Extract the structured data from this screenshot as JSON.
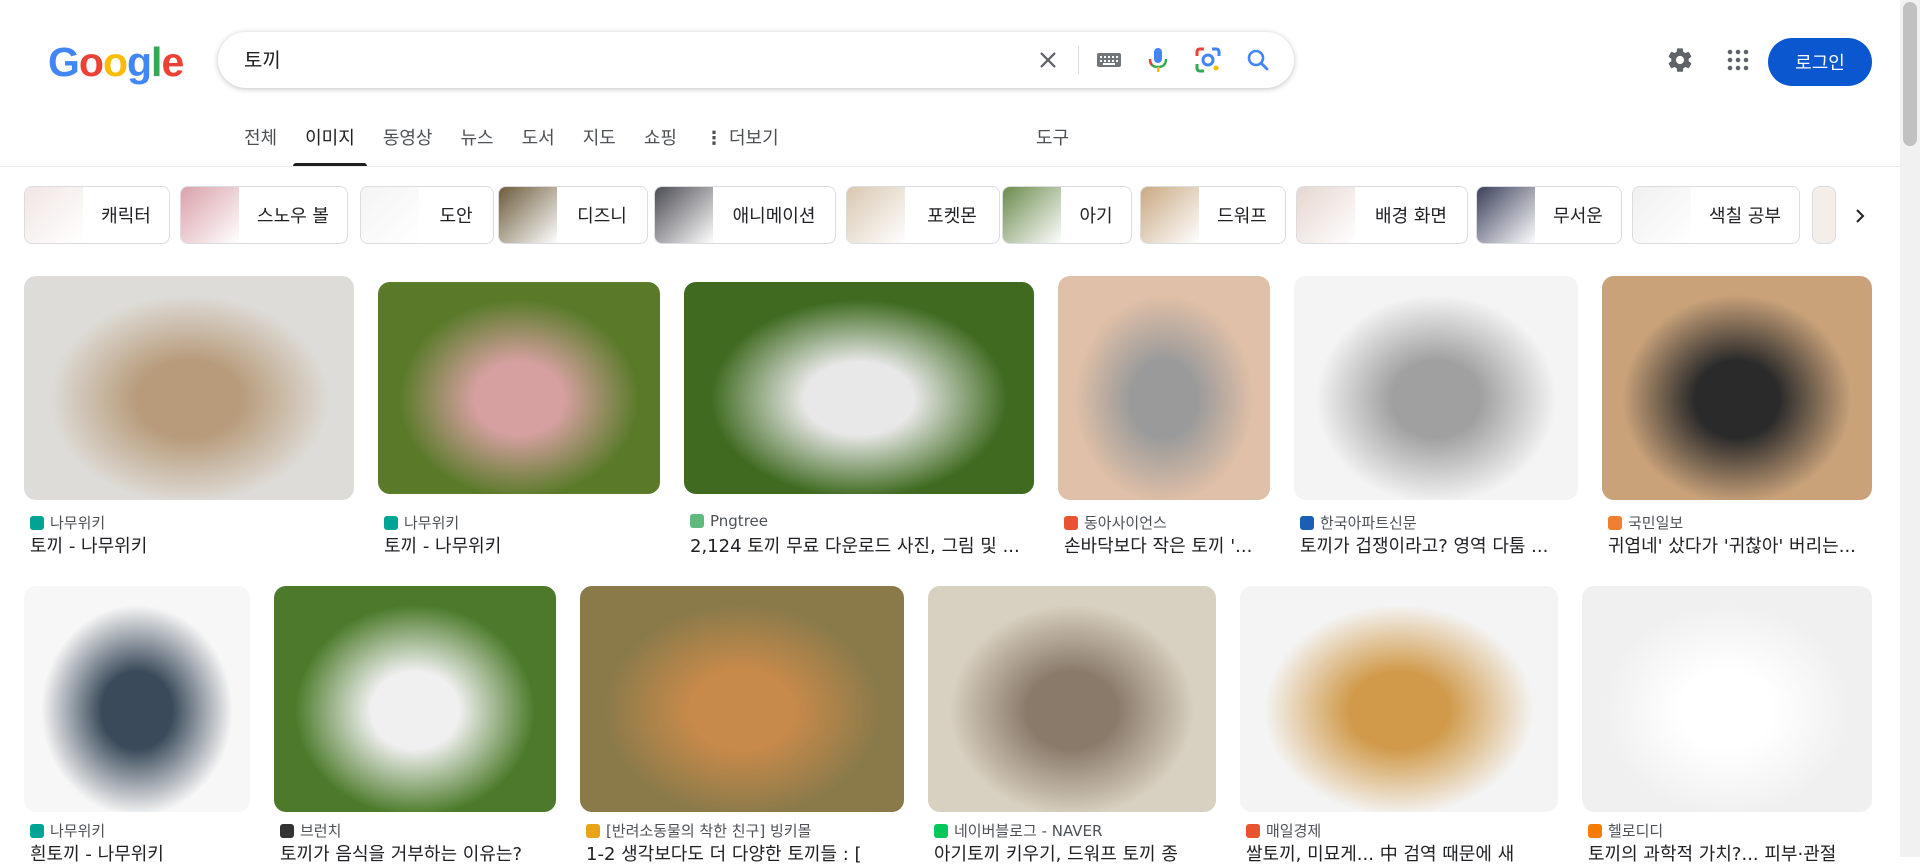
{
  "logo": {
    "letters": [
      "G",
      "o",
      "o",
      "g",
      "l",
      "e"
    ],
    "colors": [
      "#4285F4",
      "#EA4335",
      "#FBBC05",
      "#4285F4",
      "#34A853",
      "#EA4335"
    ]
  },
  "search": {
    "query": "토끼"
  },
  "header": {
    "login_label": "로그인"
  },
  "tabs": [
    {
      "label": "전체",
      "active": false
    },
    {
      "label": "이미지",
      "active": true
    },
    {
      "label": "동영상",
      "active": false
    },
    {
      "label": "뉴스",
      "active": false
    },
    {
      "label": "도서",
      "active": false
    },
    {
      "label": "지도",
      "active": false
    },
    {
      "label": "쇼핑",
      "active": false
    },
    {
      "label": "더보기",
      "active": false
    }
  ],
  "tools_label": "도구",
  "chips": [
    "캐릭터",
    "스노우 볼",
    "도안",
    "디즈니",
    "애니메이션",
    "포켓몬",
    "아기",
    "드워프",
    "배경 화면",
    "무서운",
    "색칠 공부"
  ],
  "results_row1": [
    {
      "source": "나무위키",
      "title": "토끼 - 나무위키",
      "fav_color": "#00a495"
    },
    {
      "source": "나무위키",
      "title": "토끼 - 나무위키",
      "fav_color": "#00a495"
    },
    {
      "source": "Pngtree",
      "title": "2,124 토끼 무료 다운로드 사진, 그림 및 ...",
      "fav_color": "#5fba7d"
    },
    {
      "source": "동아사이언스",
      "title": "손바닥보다 작은 토끼 '...",
      "fav_color": "#e8542f"
    },
    {
      "source": "한국아파트신문",
      "title": "토끼가 겁쟁이라고? 영역 다툼 ...",
      "fav_color": "#1a5fb4"
    },
    {
      "source": "국민일보",
      "title": "귀엽네' 샀다가 '귀찮아' 버리는...",
      "fav_color": "#f08030"
    }
  ],
  "results_row2": [
    {
      "source": "나무위키",
      "title": "흰토끼 - 나무위키",
      "fav_color": "#00a495"
    },
    {
      "source": "브런치",
      "title": "토끼가 음식을 거부하는 이유는?",
      "fav_color": "#333333"
    },
    {
      "source": "[반려소동물의 착한 친구] 빙키몰",
      "title": "1-2 생각보다도 더 다양한 토끼들 : [",
      "fav_color": "#e8a317"
    },
    {
      "source": "네이버블로그 - NAVER",
      "title": "아기토끼 키우기, 드워프 토끼 종",
      "fav_color": "#03c75a"
    },
    {
      "source": "매일경제",
      "title": "쌀토끼, 미묘게... 中 검역 때문에 새",
      "fav_color": "#e8542f"
    },
    {
      "source": "헬로디디",
      "title": "토끼의 과학적 가치?... 피부·관절",
      "fav_color": "#f57c00"
    }
  ]
}
